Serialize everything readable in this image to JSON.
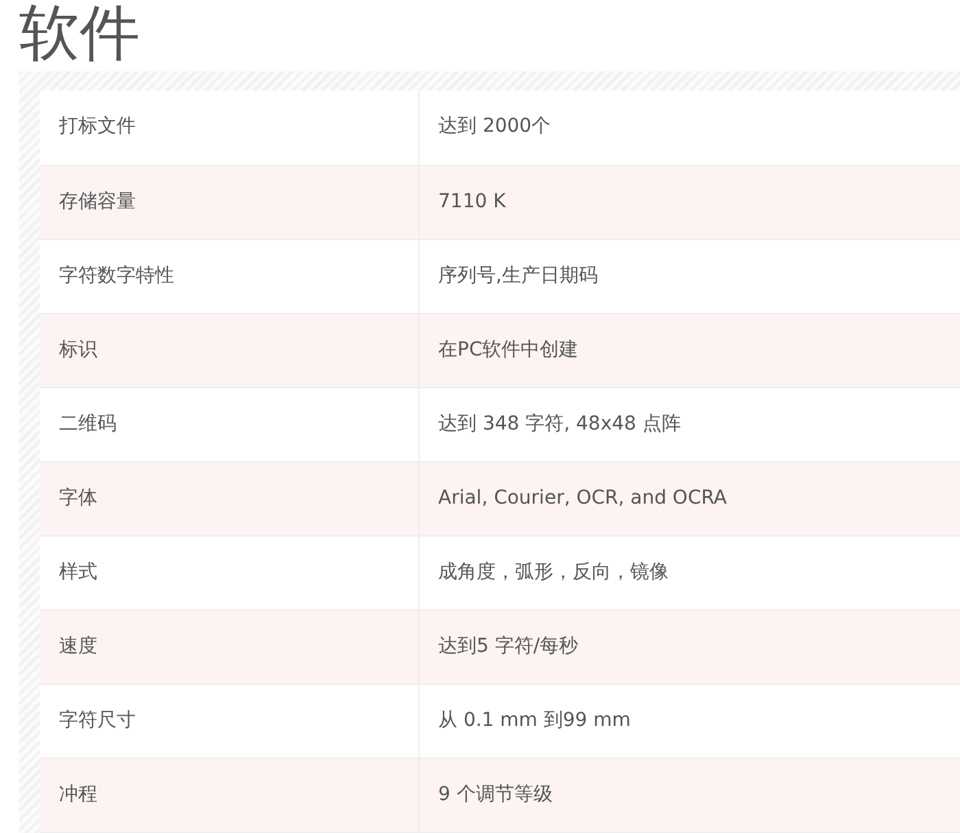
{
  "heading": "软件",
  "table": {
    "rows": [
      {
        "label": "打标文件",
        "value": "达到 2000个"
      },
      {
        "label": "存储容量",
        "value": "7110 K"
      },
      {
        "label": "字符数字特性",
        "value": "序列号,生产日期码"
      },
      {
        "label": "标识",
        "value": "在PC软件中创建"
      },
      {
        "label": "二维码",
        "value": "达到 348 字符, 48x48 点阵"
      },
      {
        "label": "字体",
        "value": "Arial, Courier, OCR, and OCRA"
      },
      {
        "label": "样式",
        "value": "成角度，弧形，反向，镜像"
      },
      {
        "label": "速度",
        "value": "达到5 字符/每秒"
      },
      {
        "label": "字符尺寸",
        "value": "从 0.1 mm 到99 mm"
      },
      {
        "label": "冲程",
        "value": "9 个调节等级"
      }
    ]
  }
}
